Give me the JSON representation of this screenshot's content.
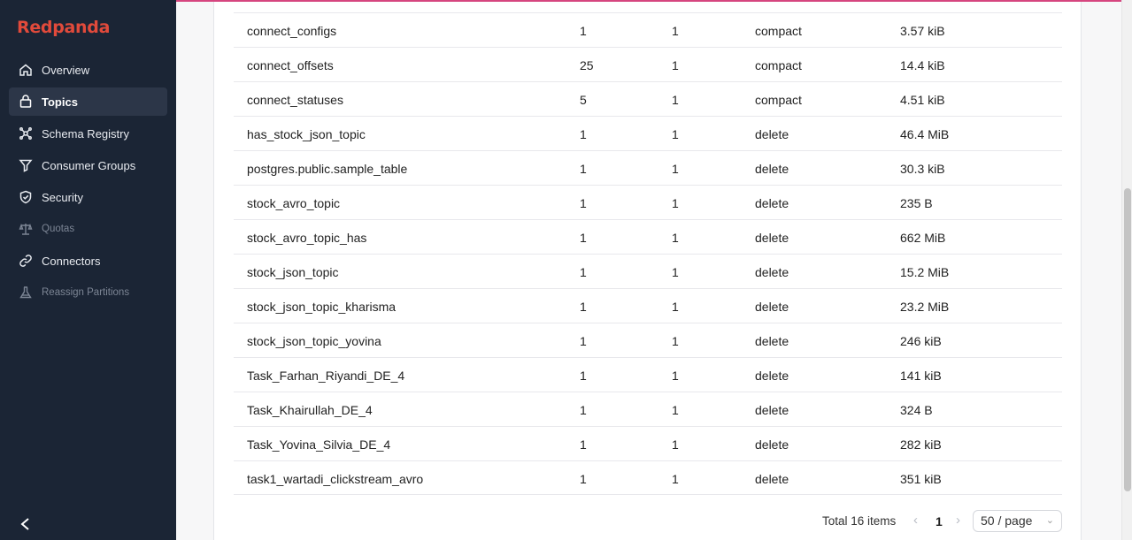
{
  "app": {
    "logo": "Redpanda"
  },
  "sidebar": {
    "items": [
      {
        "label": "Overview",
        "icon": "home-icon"
      },
      {
        "label": "Topics",
        "icon": "topics-icon",
        "active": true
      },
      {
        "label": "Schema Registry",
        "icon": "schema-icon"
      },
      {
        "label": "Consumer Groups",
        "icon": "funnel-icon"
      },
      {
        "label": "Security",
        "icon": "shield-icon"
      },
      {
        "label": "Quotas",
        "icon": "scale-icon",
        "disabled": true
      },
      {
        "label": "Connectors",
        "icon": "link-icon"
      },
      {
        "label": "Reassign Partitions",
        "icon": "flask-icon",
        "disabled": true
      }
    ],
    "collapse_icon": "chevron-left-icon"
  },
  "table": {
    "rows": [
      {
        "name": "connect_configs",
        "partitions": "1",
        "replicas": "1",
        "cleanup": "compact",
        "size": "3.57 kiB"
      },
      {
        "name": "connect_offsets",
        "partitions": "25",
        "replicas": "1",
        "cleanup": "compact",
        "size": "14.4 kiB"
      },
      {
        "name": "connect_statuses",
        "partitions": "5",
        "replicas": "1",
        "cleanup": "compact",
        "size": "4.51 kiB"
      },
      {
        "name": "has_stock_json_topic",
        "partitions": "1",
        "replicas": "1",
        "cleanup": "delete",
        "size": "46.4 MiB"
      },
      {
        "name": "postgres.public.sample_table",
        "partitions": "1",
        "replicas": "1",
        "cleanup": "delete",
        "size": "30.3 kiB"
      },
      {
        "name": "stock_avro_topic",
        "partitions": "1",
        "replicas": "1",
        "cleanup": "delete",
        "size": "235 B"
      },
      {
        "name": "stock_avro_topic_has",
        "partitions": "1",
        "replicas": "1",
        "cleanup": "delete",
        "size": "662 MiB"
      },
      {
        "name": "stock_json_topic",
        "partitions": "1",
        "replicas": "1",
        "cleanup": "delete",
        "size": "15.2 MiB"
      },
      {
        "name": "stock_json_topic_kharisma",
        "partitions": "1",
        "replicas": "1",
        "cleanup": "delete",
        "size": "23.2 MiB"
      },
      {
        "name": "stock_json_topic_yovina",
        "partitions": "1",
        "replicas": "1",
        "cleanup": "delete",
        "size": "246 kiB"
      },
      {
        "name": "Task_Farhan_Riyandi_DE_4",
        "partitions": "1",
        "replicas": "1",
        "cleanup": "delete",
        "size": "141 kiB"
      },
      {
        "name": "Task_Khairullah_DE_4",
        "partitions": "1",
        "replicas": "1",
        "cleanup": "delete",
        "size": "324 B"
      },
      {
        "name": "Task_Yovina_Silvia_DE_4",
        "partitions": "1",
        "replicas": "1",
        "cleanup": "delete",
        "size": "282 kiB"
      },
      {
        "name": "task1_wartadi_clickstream_avro",
        "partitions": "1",
        "replicas": "1",
        "cleanup": "delete",
        "size": "351 kiB"
      }
    ]
  },
  "pagination": {
    "total": "Total 16 items",
    "current_page": "1",
    "page_size": "50 / page"
  },
  "colors": {
    "sidebar_bg": "#1b2535",
    "brand": "#e14a3b",
    "accent_line": "#d6457f"
  }
}
